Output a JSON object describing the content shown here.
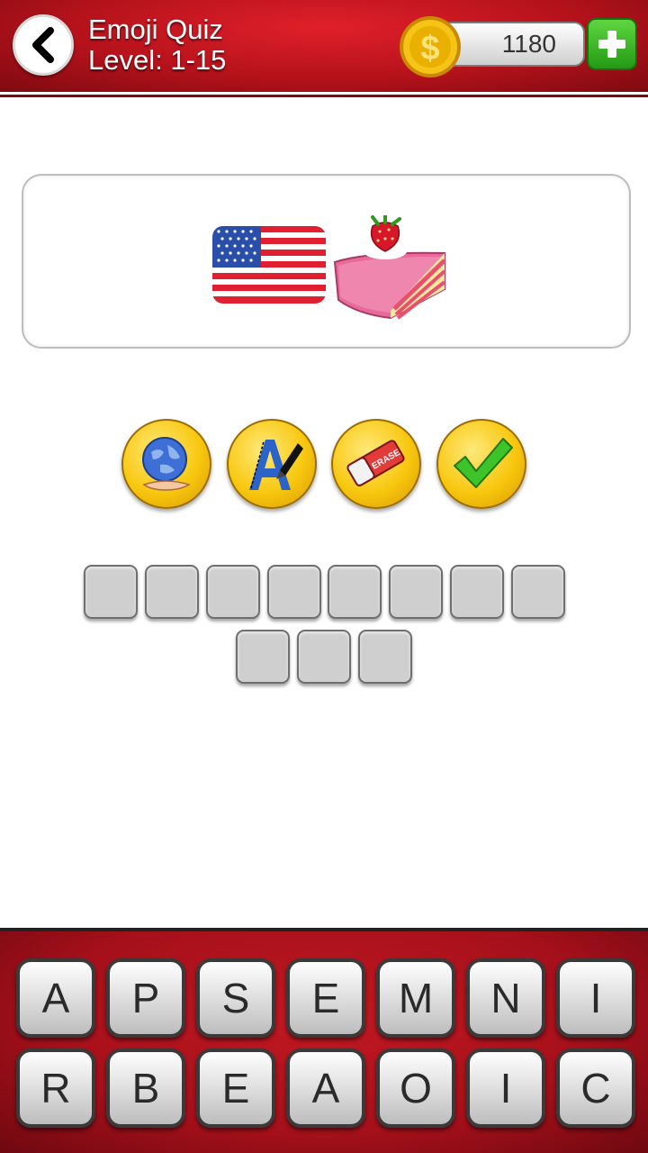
{
  "header": {
    "title_line1": "Emoji Quiz",
    "title_line2": "Level: 1-15",
    "coins": "1180"
  },
  "clue": {
    "emojis": [
      "us-flag-emoji",
      "strawberry-cake-emoji"
    ]
  },
  "helpers": [
    {
      "name": "reveal-globe-icon"
    },
    {
      "name": "reveal-letter-icon"
    },
    {
      "name": "erase-icon"
    },
    {
      "name": "solve-check-icon"
    }
  ],
  "answer": {
    "row1_slots": 8,
    "row2_slots": 3
  },
  "keyboard": {
    "row1": [
      "A",
      "P",
      "S",
      "E",
      "M",
      "N",
      "I"
    ],
    "row2": [
      "R",
      "B",
      "E",
      "A",
      "O",
      "I",
      "C"
    ]
  },
  "colors": {
    "header_red": "#b5121b",
    "gold": "#f8c70f",
    "green": "#239a14"
  }
}
